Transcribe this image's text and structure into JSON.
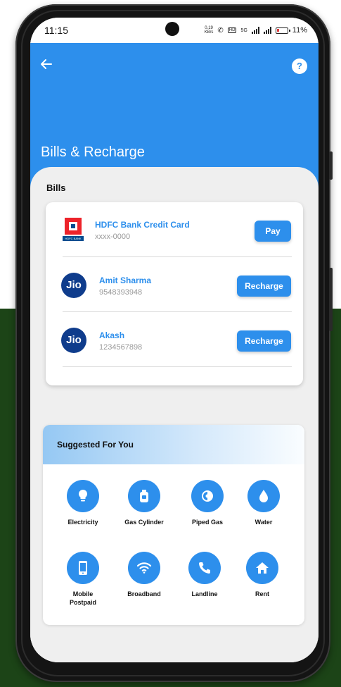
{
  "status_bar": {
    "time": "11:15",
    "net_speed": "0.19\nKB/s",
    "network": "5G",
    "battery": "11%"
  },
  "header": {
    "title": "Bills & Recharge",
    "help_label": "?"
  },
  "bills_section": {
    "label": "Bills",
    "items": [
      {
        "name": "HDFC Bank Credit Card",
        "sub": "xxxx-0000",
        "action": "Pay",
        "logo": "HDFC BANK"
      },
      {
        "name": "Amit Sharma",
        "sub": "9548393948",
        "action": "Recharge",
        "logo": "Jio"
      },
      {
        "name": "Akash",
        "sub": "1234567898",
        "action": "Recharge",
        "logo": "Jio"
      }
    ]
  },
  "suggested": {
    "title": "Suggested For You",
    "services": [
      {
        "label": "Electricity",
        "icon": "bulb-icon"
      },
      {
        "label": "Gas Cylinder",
        "icon": "gas-cylinder-icon"
      },
      {
        "label": "Piped Gas",
        "icon": "piped-gas-icon"
      },
      {
        "label": "Water",
        "icon": "water-drop-icon"
      },
      {
        "label": "Mobile\nPostpaid",
        "icon": "mobile-icon"
      },
      {
        "label": "Broadband",
        "icon": "wifi-icon"
      },
      {
        "label": "Landline",
        "icon": "phone-icon"
      },
      {
        "label": "Rent",
        "icon": "home-icon"
      }
    ]
  },
  "colors": {
    "primary": "#2d8fec",
    "background": "#efefef",
    "green_backdrop": "#1c4417"
  }
}
